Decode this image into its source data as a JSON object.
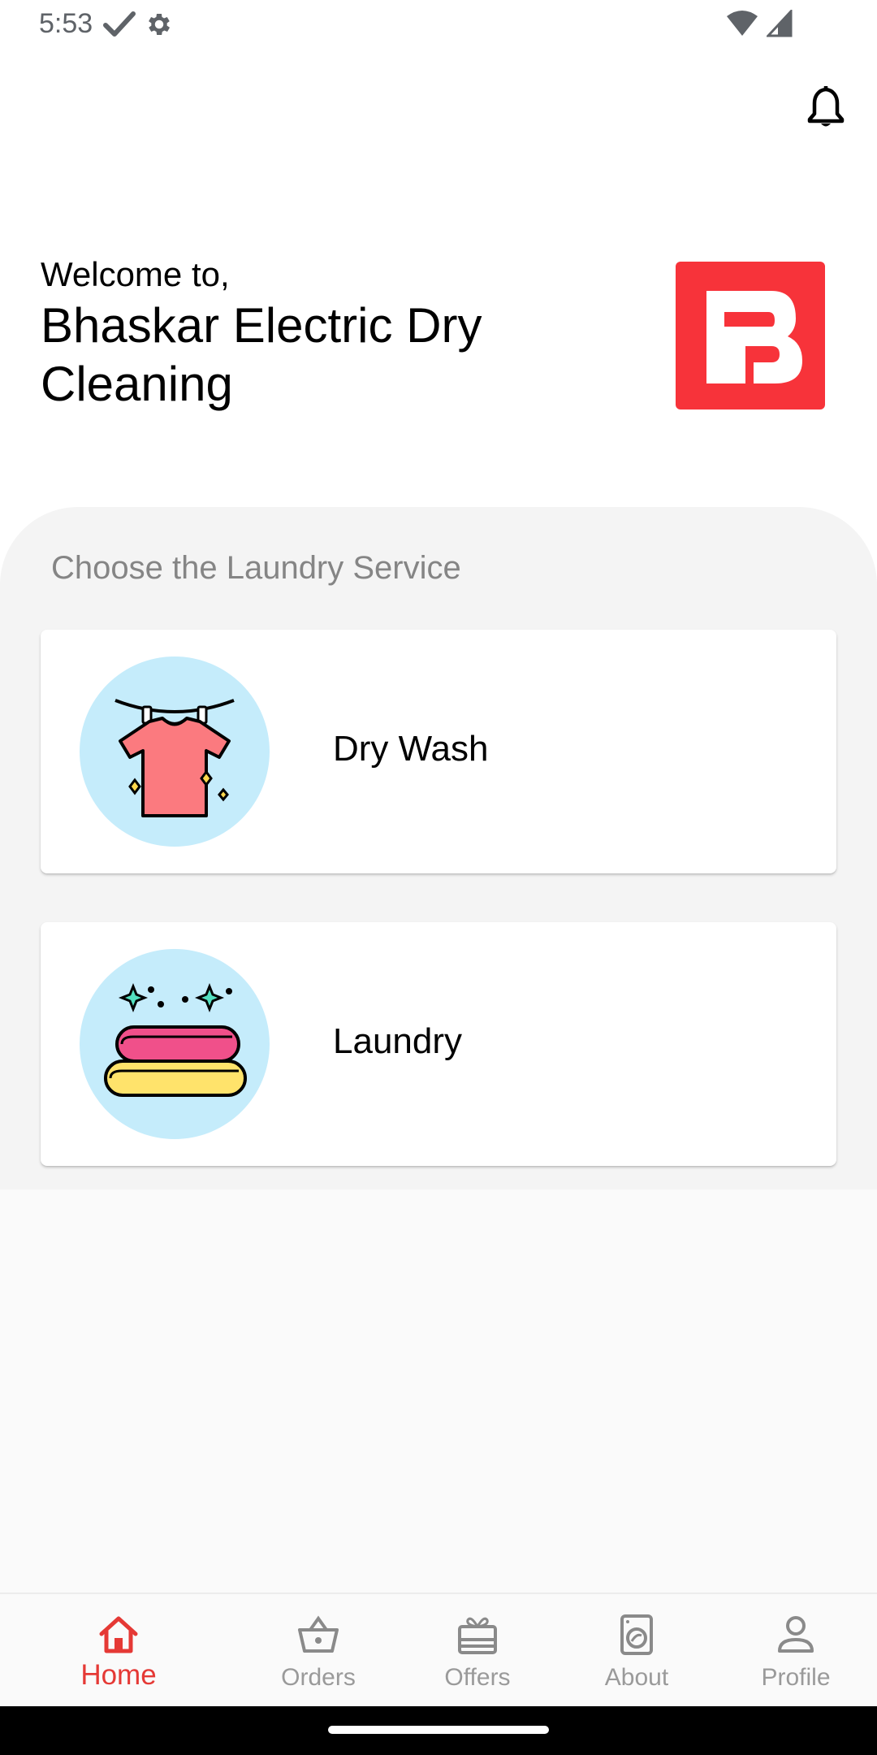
{
  "status_bar": {
    "time": "5:53",
    "left_icons": [
      "check-icon",
      "settings-gear-icon"
    ],
    "right_icons": [
      "wifi-icon",
      "cellular-signal-icon"
    ]
  },
  "header": {
    "notification_icon": "bell-icon",
    "welcome_text": "Welcome to,",
    "business_name": "Bhaskar Electric Dry Cleaning",
    "logo_icon": "brand-logo-b",
    "logo_color": "#f7333a"
  },
  "services": {
    "heading": "Choose the Laundry Service",
    "items": [
      {
        "label": "Dry Wash",
        "icon": "shirt-on-line-icon"
      },
      {
        "label": "Laundry",
        "icon": "folded-towels-icon"
      }
    ]
  },
  "bottom_nav": {
    "active_color": "#e53935",
    "inactive_color": "#9a9a9a",
    "items": [
      {
        "label": "Home",
        "icon": "home-icon",
        "active": true
      },
      {
        "label": "Orders",
        "icon": "basket-icon",
        "active": false
      },
      {
        "label": "Offers",
        "icon": "gift-card-icon",
        "active": false
      },
      {
        "label": "About",
        "icon": "washing-machine-icon",
        "active": false
      },
      {
        "label": "Profile",
        "icon": "person-icon",
        "active": false
      }
    ]
  }
}
